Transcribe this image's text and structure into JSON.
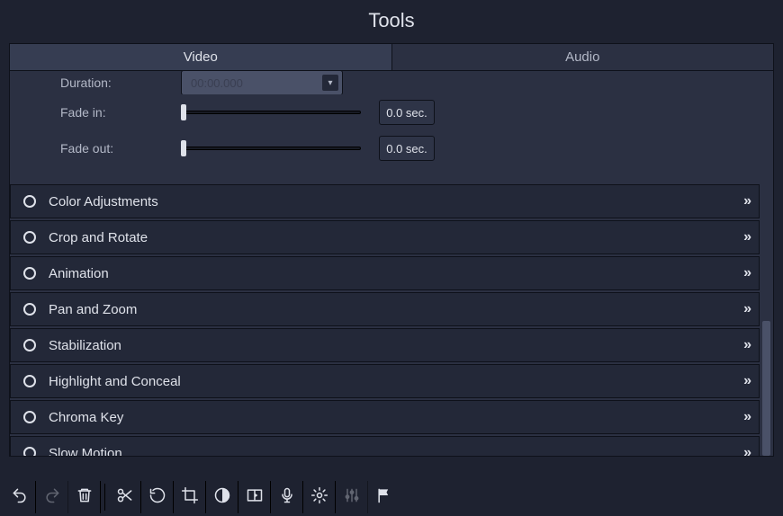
{
  "title": "Tools",
  "tabs": {
    "video": "Video",
    "audio": "Audio",
    "active": "video"
  },
  "open_section": {
    "duration_label": "Duration:",
    "duration_value": "00:00.000",
    "fade_in_label": "Fade in:",
    "fade_in_value": "0.0 sec.",
    "fade_out_label": "Fade out:",
    "fade_out_value": "0.0 sec."
  },
  "accordion": [
    "Color Adjustments",
    "Crop and Rotate",
    "Animation",
    "Pan and Zoom",
    "Stabilization",
    "Highlight and Conceal",
    "Chroma Key",
    "Slow Motion"
  ],
  "toolbar": [
    {
      "name": "undo-icon"
    },
    {
      "name": "redo-icon",
      "disabled": true
    },
    {
      "name": "trash-icon"
    },
    {
      "separator": true
    },
    {
      "name": "scissors-icon"
    },
    {
      "name": "rotate-icon"
    },
    {
      "name": "crop-icon"
    },
    {
      "name": "contrast-icon"
    },
    {
      "name": "transition-icon"
    },
    {
      "name": "mic-icon"
    },
    {
      "name": "gear-icon"
    },
    {
      "name": "equalizer-icon",
      "disabled": true
    },
    {
      "name": "flag-icon"
    }
  ]
}
